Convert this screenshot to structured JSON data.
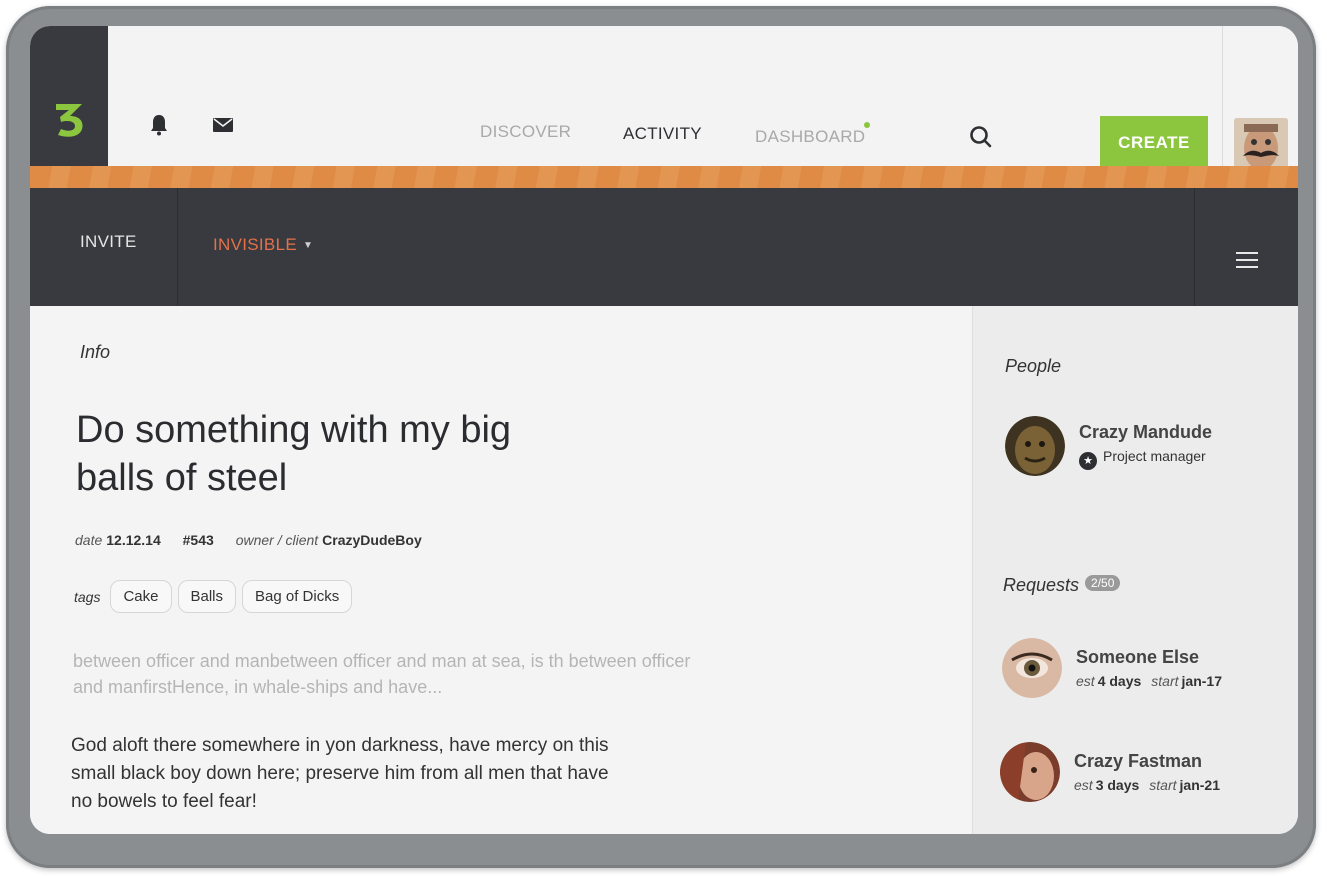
{
  "nav": {
    "items": [
      "DISCOVER",
      "ACTIVITY",
      "DASHBOARD"
    ],
    "create_label": "CREATE"
  },
  "subnav": {
    "invite_label": "INVITE",
    "visibility_label": "INVISIBLE"
  },
  "info": {
    "section_label": "Info",
    "title": "Do something with my big balls of steel",
    "date_label": "date",
    "date_value": "12.12.14",
    "id_value": "#543",
    "owner_label": "owner / client",
    "owner_value": "CrazyDudeBoy",
    "tags_label": "tags",
    "tags": [
      "Cake",
      "Balls",
      "Bag of Dicks"
    ],
    "excerpt": "between officer and manbetween officer and man at sea, is th  between officer and manfirstHence, in whale-ships and have...",
    "quote": "God aloft there somewhere in yon darkness, have mercy on this small black boy down here; preserve him from all men that have no bowels to feel fear!"
  },
  "people": {
    "section_label": "People",
    "members": [
      {
        "name": "Crazy Mandude",
        "role": "Project manager"
      }
    ]
  },
  "requests": {
    "section_label": "Requests",
    "count_badge": "2/50",
    "est_label": "est",
    "start_label": "start",
    "items": [
      {
        "name": "Someone Else",
        "est": "4 days",
        "start": "jan-17"
      },
      {
        "name": "Crazy Fastman",
        "est": "3 days",
        "start": "jan-21"
      }
    ]
  },
  "colors": {
    "accent_green": "#8cc63f",
    "accent_orange": "#e3714a",
    "dark_bar": "#383a40"
  }
}
